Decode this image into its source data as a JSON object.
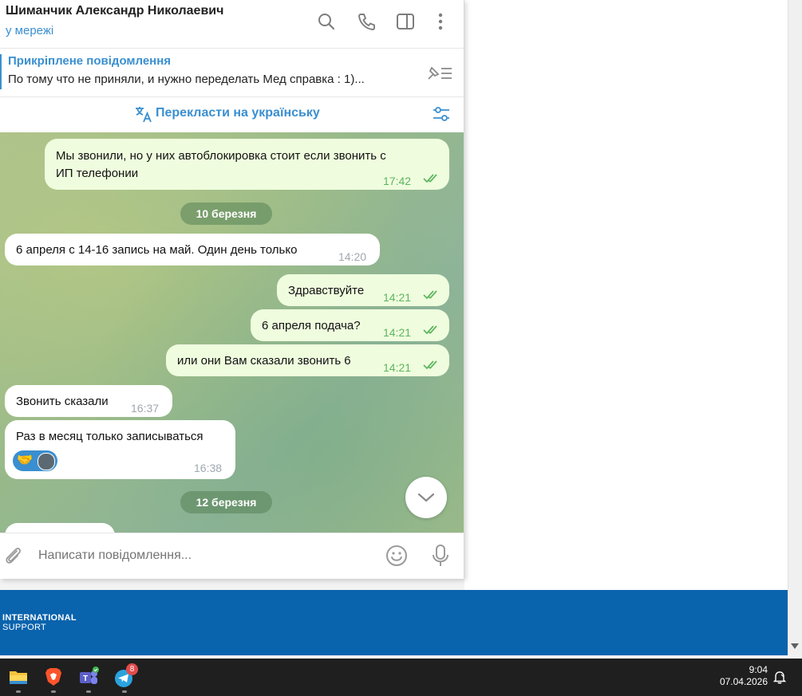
{
  "chat": {
    "name": "Шиманчик Александр Николаевич",
    "status": "у мережі"
  },
  "pinned": {
    "title": "Прикріплене повідомлення",
    "text": "По тому что не приняли, и нужно переделать Мед справка : 1)..."
  },
  "translate": {
    "label": "Перекласти на українську"
  },
  "messages": [
    {
      "dir": "out",
      "text": "Мы звонили, но у них автоблокировка стоит если звонить с",
      "text2": "ИП телефонии",
      "time": "17:42"
    },
    {
      "dir": "in",
      "text": "6 апреля с 14-16 запись на май. Один день только",
      "time": "14:20"
    },
    {
      "dir": "out",
      "text": "Здравствуйте",
      "time": "14:21"
    },
    {
      "dir": "out",
      "text": "6 апреля подача?",
      "time": "14:21"
    },
    {
      "dir": "out",
      "text": "или они Вам сказали звонить 6",
      "time": "14:21"
    },
    {
      "dir": "in",
      "text": "Звонить сказали",
      "time": "16:37"
    },
    {
      "dir": "in",
      "text": "Раз в месяц только записываться",
      "time": "16:38",
      "reaction": "🤝"
    }
  ],
  "dates": [
    "10 березня",
    "12 березня"
  ],
  "input": {
    "placeholder": "Написати повідомлення..."
  },
  "banner": {
    "line1": "INTERNATIONAL",
    "line2": "SUPPORT"
  },
  "taskbar": {
    "telegram_badge": "8",
    "time": "9:04",
    "date": "07.04.2026"
  },
  "colors": {
    "accent": "#3a8fd0",
    "outgoing": "#effdde",
    "check": "#5db55f",
    "banner": "#0a63ad"
  }
}
